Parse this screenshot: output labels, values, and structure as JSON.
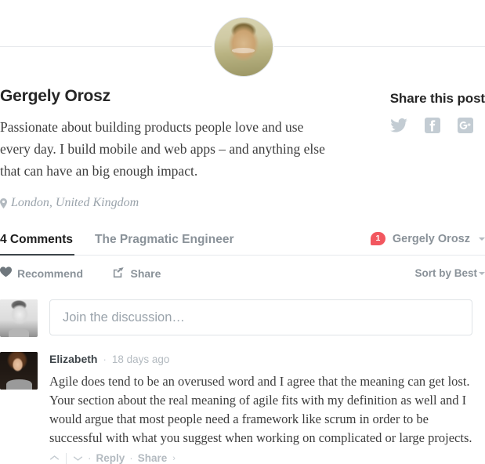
{
  "author": {
    "avatar_name": "author-avatar",
    "name": "Gergely Orosz",
    "bio": "Passionate about building products people love and use every day. I build mobile and web apps – and anything else that can have an big enough impact.",
    "location": "London, United Kingdom",
    "location_icon": "map-pin-icon"
  },
  "share": {
    "title": "Share this post",
    "icons": [
      {
        "name": "twitter-icon",
        "label": "Twitter"
      },
      {
        "name": "facebook-icon",
        "label": "Facebook"
      },
      {
        "name": "google-plus-icon",
        "label": "Google Plus"
      }
    ],
    "icon_color": "#c3ccd3"
  },
  "disqus": {
    "tabs": [
      {
        "label": "4 Comments",
        "active": true
      },
      {
        "label": "The Pragmatic Engineer",
        "active": false
      }
    ],
    "account": {
      "badge_count": "1",
      "badge_color": "#f2575f",
      "name": "Gergely Orosz",
      "caret_icon": "chevron-down-icon"
    },
    "actions": {
      "recommend_label": "Recommend",
      "recommend_icon": "heart-icon",
      "share_label": "Share",
      "share_icon": "share-box-icon",
      "sort_label": "Sort by Best",
      "sort_caret_icon": "chevron-down-icon"
    },
    "composer": {
      "avatar_name": "current-user-avatar",
      "placeholder": "Join the discussion…"
    },
    "comments": [
      {
        "avatar_name": "commenter-avatar",
        "author": "Elizabeth",
        "separator": "·",
        "time": "18 days ago",
        "text": "Agile does tend to be an overused word and I agree that the meaning can get lost. Your section about the real meaning of agile fits with my definition as well and I would argue that most people need a framework like scrum in order to be successful with what you suggest when working on complicated or large projects.",
        "footer": {
          "upvote_icon": "chevron-up-icon",
          "downvote_icon": "chevron-down-icon",
          "dot": "·",
          "reply_label": "Reply",
          "share_label": "Share",
          "share_chevron": "›"
        }
      }
    ]
  }
}
